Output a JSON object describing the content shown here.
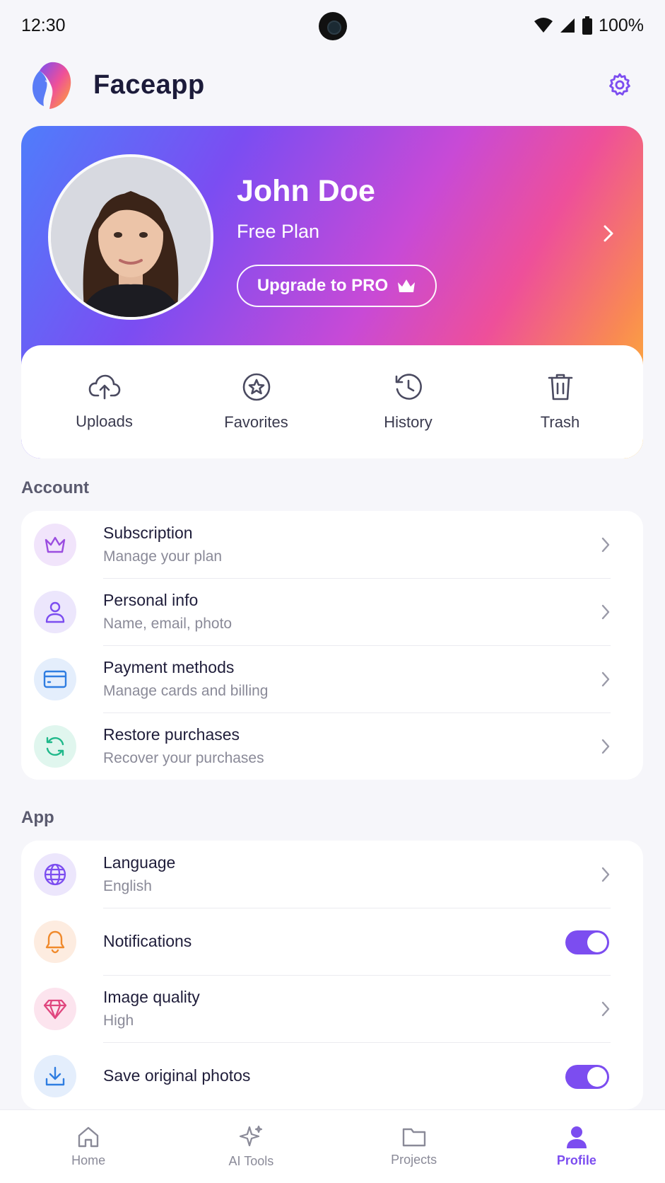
{
  "status_bar": {
    "time": "12:30",
    "battery": "100%"
  },
  "header": {
    "app_name": "Faceapp"
  },
  "profile": {
    "name": "John Doe",
    "plan": "Free Plan",
    "upgrade_label": "Upgrade to PRO"
  },
  "quick_actions": [
    {
      "label": "Uploads",
      "icon": "cloud-upload-icon"
    },
    {
      "label": "Favorites",
      "icon": "star-icon"
    },
    {
      "label": "History",
      "icon": "history-icon"
    },
    {
      "label": "Trash",
      "icon": "trash-icon"
    }
  ],
  "account": {
    "title": "Account",
    "items": [
      {
        "title": "Subscription",
        "subtitle": "Manage your plan",
        "icon": "crown-icon",
        "color": "#9b4de0"
      },
      {
        "title": "Personal info",
        "subtitle": "Name, email, photo",
        "icon": "user-icon",
        "color": "#7c4df0"
      },
      {
        "title": "Payment methods",
        "subtitle": "Manage cards and billing",
        "icon": "credit-card-icon",
        "color": "#2f7de1"
      },
      {
        "title": "Restore purchases",
        "subtitle": "Recover your purchases",
        "icon": "refresh-icon",
        "color": "#1fb88a"
      }
    ]
  },
  "app": {
    "title": "App",
    "items": [
      {
        "title": "Language",
        "subtitle": "English",
        "icon": "globe-icon",
        "color": "#7c4df0"
      },
      {
        "title": "Notifications",
        "icon": "bell-icon",
        "color": "#f08a2c",
        "toggle_on": true
      },
      {
        "title": "Image quality",
        "subtitle": "High",
        "icon": "diamond-icon",
        "color": "#e0467e"
      },
      {
        "title": "Save original photos",
        "icon": "download-icon",
        "color": "#2f7de1",
        "toggle_on": true
      }
    ]
  },
  "bottom_nav": {
    "items": [
      {
        "label": "Home",
        "icon": "home-icon"
      },
      {
        "label": "AI Tools",
        "icon": "sparkle-icon"
      },
      {
        "label": "Projects",
        "icon": "folder-icon"
      },
      {
        "label": "Profile",
        "icon": "profile-icon",
        "active": true
      }
    ]
  },
  "colors": {
    "accent": "#7c4df0",
    "text": "#1f1d3a",
    "muted": "#8a8a98"
  }
}
